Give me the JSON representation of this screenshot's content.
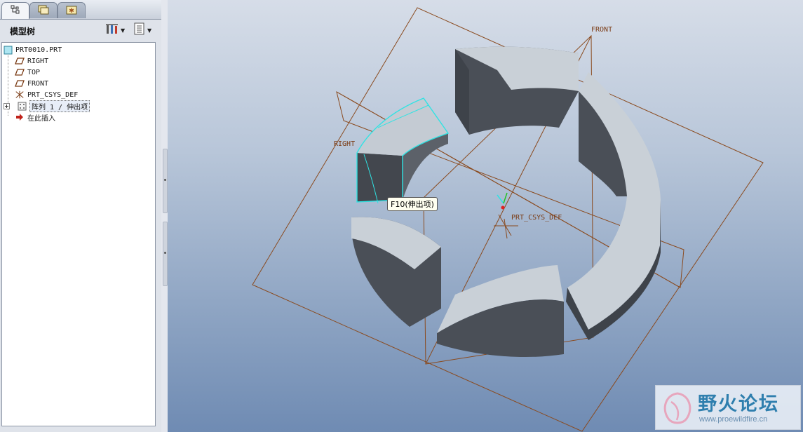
{
  "panel": {
    "title": "模型树",
    "tabs": [
      {
        "icon": "model-tree-icon"
      },
      {
        "icon": "folder-browser-icon"
      },
      {
        "icon": "favorites-icon"
      }
    ],
    "header_buttons": [
      {
        "icon": "tree-settings-icon"
      },
      {
        "icon": "show-menu-icon"
      }
    ]
  },
  "tree": {
    "items": [
      {
        "label": "PRT0010.PRT",
        "icon": "part-icon"
      },
      {
        "label": "RIGHT",
        "icon": "datum-plane-icon"
      },
      {
        "label": "TOP",
        "icon": "datum-plane-icon"
      },
      {
        "label": "FRONT",
        "icon": "datum-plane-icon"
      },
      {
        "label": "PRT_CSYS_DEF",
        "icon": "coordinate-system-icon"
      },
      {
        "label": "阵列 1 / 伸出项",
        "icon": "pattern-icon",
        "expand": "+"
      },
      {
        "label": "在此插入",
        "icon": "insert-here-arrow-icon"
      }
    ]
  },
  "viewport": {
    "plane_labels": {
      "front": "FRONT",
      "right": "RIGHT",
      "csys": "PRT_CSYS_DEF"
    },
    "tooltip": "F10(伸出项)",
    "watermark": {
      "title": "野火论坛",
      "url": "www.proewildfire.cn"
    },
    "colors": {
      "datum": "#8a4a1e",
      "highlight": "#2fe3e3",
      "solid_top": "#c9d0d7",
      "solid_side": "#4a4f57"
    }
  }
}
